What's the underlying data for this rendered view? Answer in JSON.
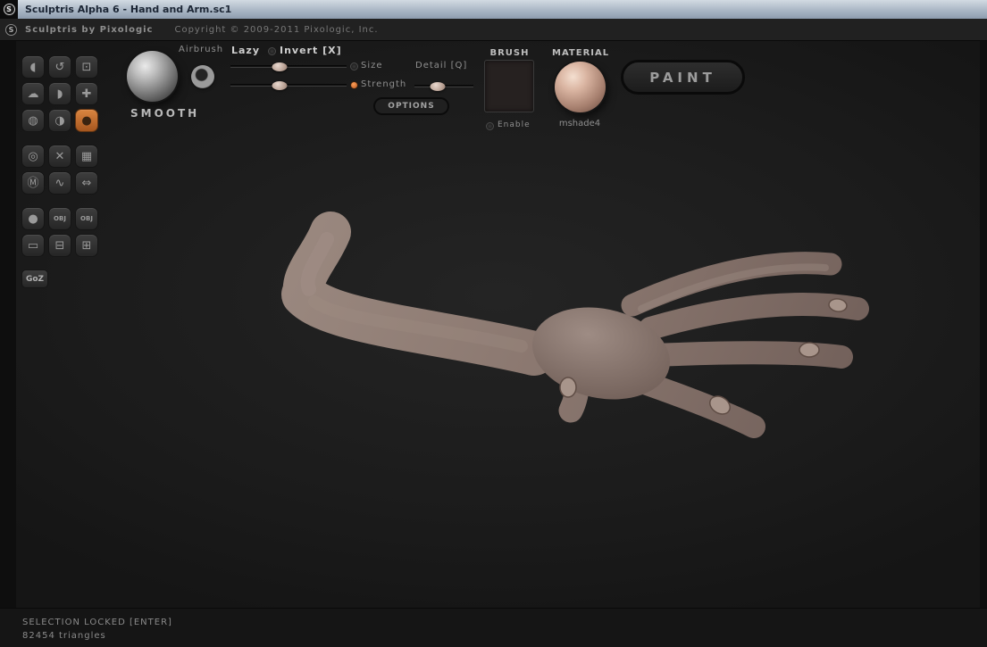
{
  "window": {
    "title": "Sculptris Alpha 6 - Hand and Arm.sc1",
    "logo_letter": "S"
  },
  "menubar": {
    "logo_letter": "S",
    "app_name": "Sculptris by Pixologic",
    "copyright": "Copyright © 2009-2011 Pixologic, Inc."
  },
  "sidebar": {
    "tools": [
      {
        "name": "crease",
        "glyph": "◖"
      },
      {
        "name": "rotate",
        "glyph": "↺"
      },
      {
        "name": "scale",
        "glyph": "⊡"
      },
      {
        "name": "draw",
        "glyph": "☁"
      },
      {
        "name": "flatten",
        "glyph": "◗"
      },
      {
        "name": "grab",
        "glyph": "✚"
      },
      {
        "name": "inflate",
        "glyph": "◍"
      },
      {
        "name": "pinch",
        "glyph": "◑"
      },
      {
        "name": "smooth",
        "glyph": "●",
        "selected": true
      },
      {
        "name": "wireframe",
        "glyph": "◎"
      },
      {
        "name": "symmetry",
        "glyph": "✕"
      },
      {
        "name": "grid",
        "glyph": "▦"
      },
      {
        "name": "mask",
        "glyph": "Ⓜ"
      },
      {
        "name": "wrinkle",
        "glyph": "∿"
      },
      {
        "name": "reduce",
        "glyph": "⇔"
      },
      {
        "name": "new-sphere",
        "glyph": "●"
      },
      {
        "name": "import-obj",
        "glyph": "OBJ"
      },
      {
        "name": "export-obj",
        "glyph": "OBJ"
      },
      {
        "name": "new-plane",
        "glyph": "▭"
      },
      {
        "name": "save",
        "glyph": "⊟"
      },
      {
        "name": "open",
        "glyph": "⊞"
      }
    ],
    "goz_label": "GoZ"
  },
  "toolbar": {
    "brush_name": "SMOOTH",
    "airbrush_label": "Airbrush",
    "lazy_label": "Lazy",
    "invert_label": "Invert [X]",
    "size_label": "Size",
    "detail_label": "Detail [Q]",
    "strength_label": "Strength",
    "options_label": "OPTIONS",
    "brush_section_label": "BRUSH",
    "enable_label": "Enable",
    "material_section_label": "MATERIAL",
    "material_name": "mshade4",
    "paint_label": "PAINT",
    "sliders": {
      "size_pct": 42,
      "strength_pct": 42,
      "detail_pct": 40
    }
  },
  "statusbar": {
    "selection": "SELECTION LOCKED [ENTER]",
    "triangles": "82454 triangles"
  },
  "colors": {
    "accent_orange": "#c4702f",
    "titlebar_top": "#d2dae2",
    "titlebar_bottom": "#8d9cae",
    "skin_light": "#a2918a",
    "skin_dark": "#6b5a53",
    "canvas_bg": "#1b1b1b"
  }
}
